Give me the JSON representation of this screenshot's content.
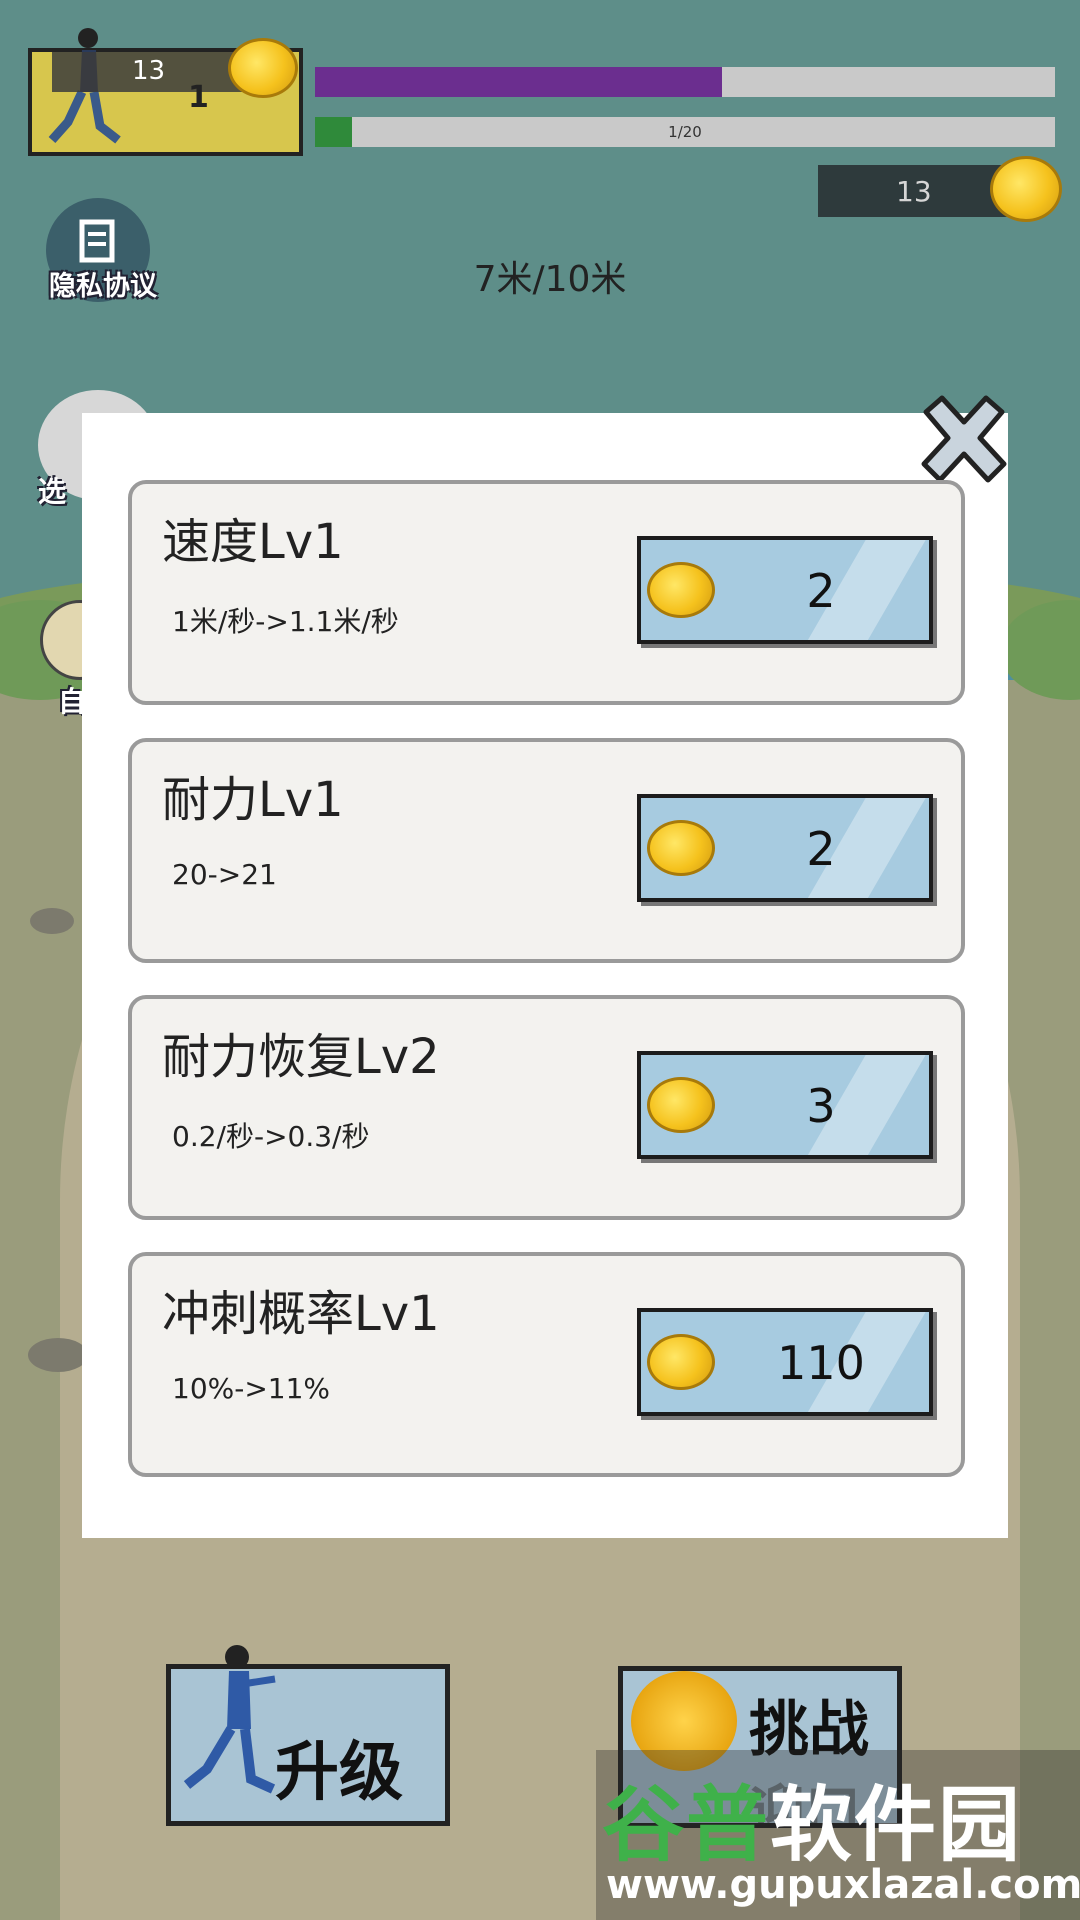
{
  "hud": {
    "level_gold": "13",
    "level_num": "1",
    "stamina_progress": 0.55,
    "stage_progress_text": "1/20",
    "stage_progress": 0.05,
    "coins": "13",
    "privacy_label": "隐私协议",
    "distance_text": "7米/10米",
    "select_label": "选",
    "auto_label": "自"
  },
  "upgrades": [
    {
      "title": "速度Lv1",
      "desc": "1米/秒->1.1米/秒",
      "cost": "2"
    },
    {
      "title": "耐力Lv1",
      "desc": "20->21",
      "cost": "2"
    },
    {
      "title": "耐力恢复Lv2",
      "desc": "0.2/秒->0.3/秒",
      "cost": "3"
    },
    {
      "title": "冲刺概率Lv1",
      "desc": "10%->11%",
      "cost": "110"
    }
  ],
  "bottom": {
    "upgrade_label": "升级",
    "challenge_label": "挑战",
    "challenge_sub": "迎口"
  },
  "watermark": {
    "name_part1": "谷普",
    "name_part2": "软件园",
    "url": "www.gupuxlazal.com"
  },
  "colors": {
    "stamina_fill": "#6b2e8f",
    "stage_fill": "#2f8a3a",
    "button_blue": "#a7cbe0"
  },
  "icons": [
    "close-icon",
    "coin-icon",
    "privacy-icon",
    "runner-icon"
  ]
}
